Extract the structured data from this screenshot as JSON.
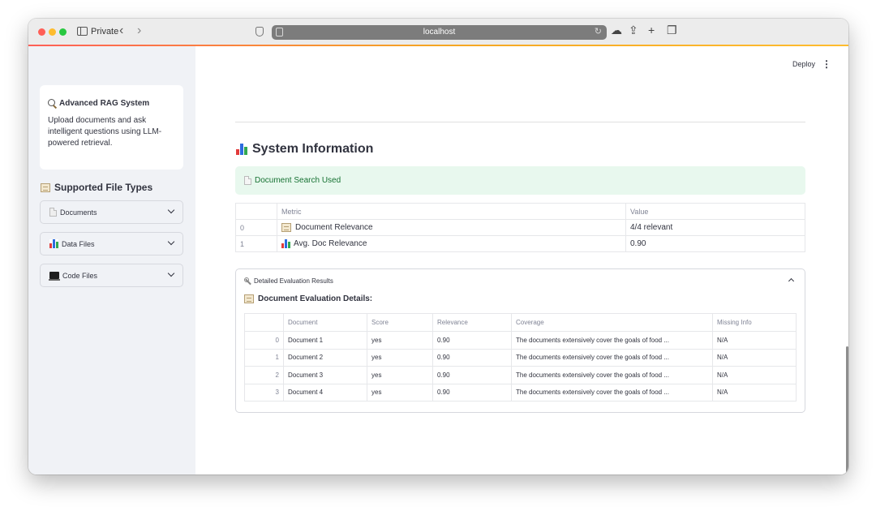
{
  "browser": {
    "private_label": "Private",
    "url": "localhost"
  },
  "sidebar": {
    "card_title": "Advanced RAG System",
    "card_desc": "Upload documents and ask intelligent questions using LLM-powered retrieval.",
    "section_title": "Supported File Types",
    "expanders": [
      {
        "label": "Documents",
        "icon": "page-icon"
      },
      {
        "label": "Data Files",
        "icon": "bar-chart-icon"
      },
      {
        "label": "Code Files",
        "icon": "laptop-icon"
      }
    ]
  },
  "header": {
    "deploy_label": "Deploy",
    "menu_label": "⋮"
  },
  "main": {
    "title": "System Information",
    "alert_text": "Document Search Used",
    "alert_color": "#177233",
    "metrics_table": {
      "headers": [
        "",
        "Metric",
        "Value"
      ],
      "rows": [
        {
          "index": "0",
          "metric": "Document Relevance",
          "value": "4/4 relevant",
          "icon": "ledger-icon"
        },
        {
          "index": "1",
          "metric": "Avg. Doc Relevance",
          "value": "0.90",
          "icon": "bar-chart-icon"
        }
      ]
    },
    "evaluation": {
      "expander_label": "Detailed Evaluation Results",
      "subtitle": "Document Evaluation Details:",
      "headers": [
        "",
        "Document",
        "Score",
        "Relevance",
        "Coverage",
        "Missing Info"
      ],
      "rows": [
        {
          "index": "0",
          "document": "Document 1",
          "score": "yes",
          "relevance": "0.90",
          "coverage": "The documents extensively cover the goals of food ...",
          "missing": "N/A"
        },
        {
          "index": "1",
          "document": "Document 2",
          "score": "yes",
          "relevance": "0.90",
          "coverage": "The documents extensively cover the goals of food ...",
          "missing": "N/A"
        },
        {
          "index": "2",
          "document": "Document 3",
          "score": "yes",
          "relevance": "0.90",
          "coverage": "The documents extensively cover the goals of food ...",
          "missing": "N/A"
        },
        {
          "index": "3",
          "document": "Document 4",
          "score": "yes",
          "relevance": "0.90",
          "coverage": "The documents extensively cover the goals of food ...",
          "missing": "N/A"
        }
      ]
    }
  }
}
